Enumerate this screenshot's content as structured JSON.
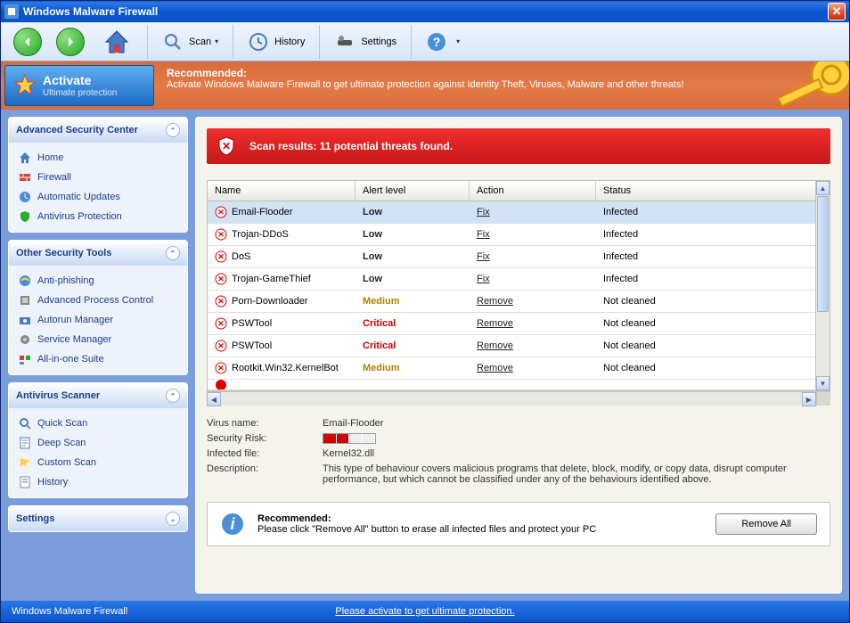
{
  "window": {
    "title": "Windows Malware Firewall"
  },
  "toolbar": {
    "scan": "Scan",
    "history": "History",
    "settings": "Settings"
  },
  "banner": {
    "activate": "Activate",
    "activate_sub": "Ultimate protection",
    "rec_title": "Recommended:",
    "rec_text": "Activate Windows Malware Firewall to get ultimate protection against Identity Theft, Viruses, Malware and other threats!"
  },
  "sidebar": {
    "panels": [
      {
        "title": "Advanced Security Center",
        "items": [
          "Home",
          "Firewall",
          "Automatic Updates",
          "Antivirus Protection"
        ]
      },
      {
        "title": "Other Security Tools",
        "items": [
          "Anti-phishing",
          "Advanced Process Control",
          "Autorun Manager",
          "Service Manager",
          "All-in-one Suite"
        ]
      },
      {
        "title": "Antivirus Scanner",
        "items": [
          "Quick Scan",
          "Deep Scan",
          "Custom Scan",
          "History"
        ]
      },
      {
        "title": "Settings",
        "items": []
      }
    ]
  },
  "scan": {
    "header": "Scan results: 11 potential threats found.",
    "columns": {
      "name": "Name",
      "alert": "Alert level",
      "action": "Action",
      "status": "Status"
    },
    "rows": [
      {
        "name": "Email-Flooder",
        "alert": "Low",
        "alert_cls": "low",
        "action": "Fix",
        "status": "Infected",
        "selected": true
      },
      {
        "name": "Trojan-DDoS",
        "alert": "Low",
        "alert_cls": "low",
        "action": "Fix",
        "status": "Infected"
      },
      {
        "name": "DoS",
        "alert": "Low",
        "alert_cls": "low",
        "action": "Fix",
        "status": "Infected"
      },
      {
        "name": "Trojan-GameThief",
        "alert": "Low",
        "alert_cls": "low",
        "action": "Fix",
        "status": "Infected"
      },
      {
        "name": "Porn-Downloader",
        "alert": "Medium",
        "alert_cls": "medium",
        "action": "Remove",
        "status": "Not cleaned"
      },
      {
        "name": "PSWTool",
        "alert": "Critical",
        "alert_cls": "critical",
        "action": "Remove",
        "status": "Not cleaned"
      },
      {
        "name": "PSWTool",
        "alert": "Critical",
        "alert_cls": "critical",
        "action": "Remove",
        "status": "Not cleaned"
      },
      {
        "name": "Rootkit.Win32.KernelBot",
        "alert": "Medium",
        "alert_cls": "medium",
        "action": "Remove",
        "status": "Not cleaned"
      }
    ]
  },
  "detail": {
    "labels": {
      "vname": "Virus name:",
      "risk": "Security Risk:",
      "file": "Infected file:",
      "desc": "Description:"
    },
    "virus_name": "Email-Flooder",
    "infected_file": "Kernel32.dll",
    "description": "This type of behaviour covers malicious programs that delete, block, modify, or copy data, disrupt computer performance, but which cannot be classified under any of the behaviours identified above."
  },
  "footer_rec": {
    "title": "Recommended:",
    "text": "Please click \"Remove All\" button to erase all infected files and protect your PC",
    "button": "Remove All"
  },
  "statusbar": {
    "left": "Windows Malware Firewall",
    "center": "Please activate to get ultimate protection."
  }
}
